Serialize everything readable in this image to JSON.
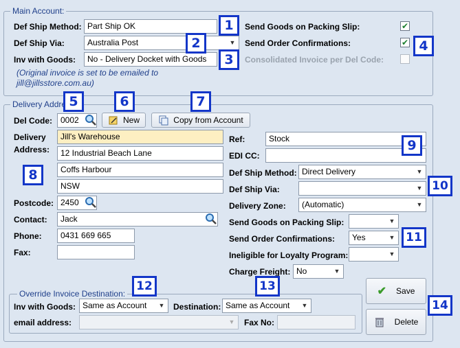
{
  "main_account": {
    "legend": "Main Account:",
    "def_ship_method_label": "Def Ship Method:",
    "def_ship_method_value": "Part Ship OK",
    "def_ship_via_label": "Def Ship Via:",
    "def_ship_via_value": "Australia Post",
    "inv_with_goods_label": "Inv with Goods:",
    "inv_with_goods_value": "No - Delivery Docket with Goods",
    "note_line1": "(Original invoice is set to be emailed to",
    "note_line2": "jill@jillsstore.com.au)",
    "send_goods_label": "Send Goods on Packing Slip:",
    "send_goods_checked": true,
    "send_order_conf_label": "Send Order Confirmations:",
    "send_order_conf_checked": true,
    "consolidated_label": "Consolidated Invoice per Del Code:",
    "consolidated_checked": false
  },
  "delivery": {
    "legend": "Delivery Address:",
    "del_code_label": "Del Code:",
    "del_code_value": "0002",
    "new_button": "New",
    "copy_button": "Copy from Account",
    "address_label_1": "Delivery",
    "address_label_2": "Address:",
    "address_lines": [
      "Jill's Warehouse",
      "12 Industrial Beach Lane",
      "Coffs Harbour",
      "NSW"
    ],
    "postcode_label": "Postcode:",
    "postcode_value": "2450",
    "contact_label": "Contact:",
    "contact_value": "Jack",
    "phone_label": "Phone:",
    "phone_value": "0431 669 665",
    "fax_label": "Fax:",
    "fax_value": "",
    "ref_label": "Ref:",
    "ref_value": "Stock",
    "edi_cc_label": "EDI CC:",
    "edi_cc_value": "",
    "def_ship_method_label": "Def Ship Method:",
    "def_ship_method_value": "Direct Delivery",
    "def_ship_via_label": "Def Ship Via:",
    "def_ship_via_value": "",
    "delivery_zone_label": "Delivery Zone:",
    "delivery_zone_value": "(Automatic)",
    "send_goods_label": "Send Goods on Packing Slip:",
    "send_goods_value": "",
    "send_order_conf_label": "Send Order Confirmations:",
    "send_order_conf_value": "Yes",
    "loyalty_label": "Ineligible for Loyalty Program:",
    "loyalty_value": "",
    "charge_freight_label": "Charge Freight:",
    "charge_freight_value": "No"
  },
  "override": {
    "legend": "Override Invoice Destination:",
    "inv_with_goods_label": "Inv with Goods:",
    "inv_with_goods_value": "Same as Account",
    "destination_label": "Destination:",
    "destination_value": "Same as Account",
    "email_label": "email address:",
    "email_value": "",
    "fax_no_label": "Fax No:",
    "fax_no_value": ""
  },
  "actions": {
    "save_button": "Save",
    "delete_button": "Delete"
  },
  "badges": [
    "1",
    "2",
    "3",
    "4",
    "5",
    "6",
    "7",
    "8",
    "9",
    "10",
    "11",
    "12",
    "13",
    "14"
  ],
  "colors": {
    "background": "#dde6f1",
    "legend_text": "#1f3f8a",
    "badge_border": "#1336c8",
    "highlight_field": "#fdefc2"
  }
}
